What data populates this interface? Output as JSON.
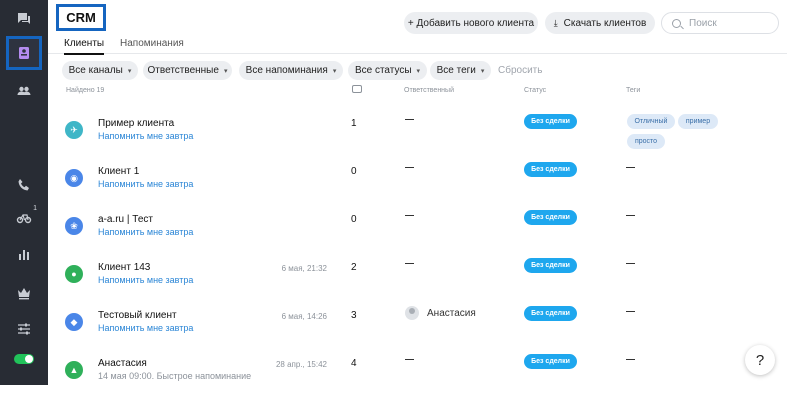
{
  "page": {
    "title": "CRM"
  },
  "header": {
    "add_client": "+ Добавить нового клиента",
    "download": "Скачать клиентов",
    "search_placeholder": "Поиск"
  },
  "tabs": [
    {
      "label": "Клиенты",
      "active": true
    },
    {
      "label": "Напоминания",
      "active": false
    }
  ],
  "filters": [
    "Все каналы",
    "Ответственные",
    "Все напоминания",
    "Все статусы",
    "Все теги"
  ],
  "reset_label": "Сбросить",
  "table": {
    "found": "Найдено 19",
    "col_responsible": "Ответственный",
    "col_status": "Статус",
    "col_tags": "Теги",
    "rows": [
      {
        "name": "Пример клиента",
        "sub": "Напомнить мне завтра",
        "date": "",
        "count": "1",
        "responsible": "",
        "status": "Без сделки",
        "tags": [
          "Отличный",
          "пример",
          "просто"
        ],
        "avatar_color": "#3fb6c7"
      },
      {
        "name": "Клиент 1",
        "sub": "Напомнить мне завтра",
        "date": "",
        "count": "0",
        "responsible": "",
        "status": "Без сделки",
        "tags": [],
        "avatar_color": "#4a86e8"
      },
      {
        "name": "a-a.ru | Тест",
        "sub": "Напомнить мне завтра",
        "date": "",
        "count": "0",
        "responsible": "",
        "status": "Без сделки",
        "tags": [],
        "avatar_color": "#4a86e8"
      },
      {
        "name": "Клиент 143",
        "sub": "Напомнить мне завтра",
        "date": "6 мая, 21:32",
        "count": "2",
        "responsible": "",
        "status": "Без сделки",
        "tags": [],
        "avatar_color": "#2fb05a"
      },
      {
        "name": "Тестовый клиент",
        "sub": "Напомнить мне завтра",
        "date": "6 мая, 14:26",
        "count": "3",
        "responsible": "Анастасия",
        "status": "Без сделки",
        "tags": [],
        "avatar_color": "#4a86e8"
      },
      {
        "name": "Анастасия",
        "sub": "14 мая 09:00. Быстрое напоминание",
        "date": "28 апр., 15:42",
        "count": "4",
        "responsible": "",
        "status": "Без сделки",
        "tags": [],
        "avatar_color": "#2fb05a"
      }
    ]
  },
  "sidebar": {
    "icons": [
      "chat-icon",
      "crm-icon",
      "users-icon",
      "phone-icon",
      "bike-icon",
      "analytics-icon",
      "crown-icon",
      "settings-sliders-icon",
      "toggle-icon"
    ],
    "badge": "1"
  },
  "help_label": "?"
}
